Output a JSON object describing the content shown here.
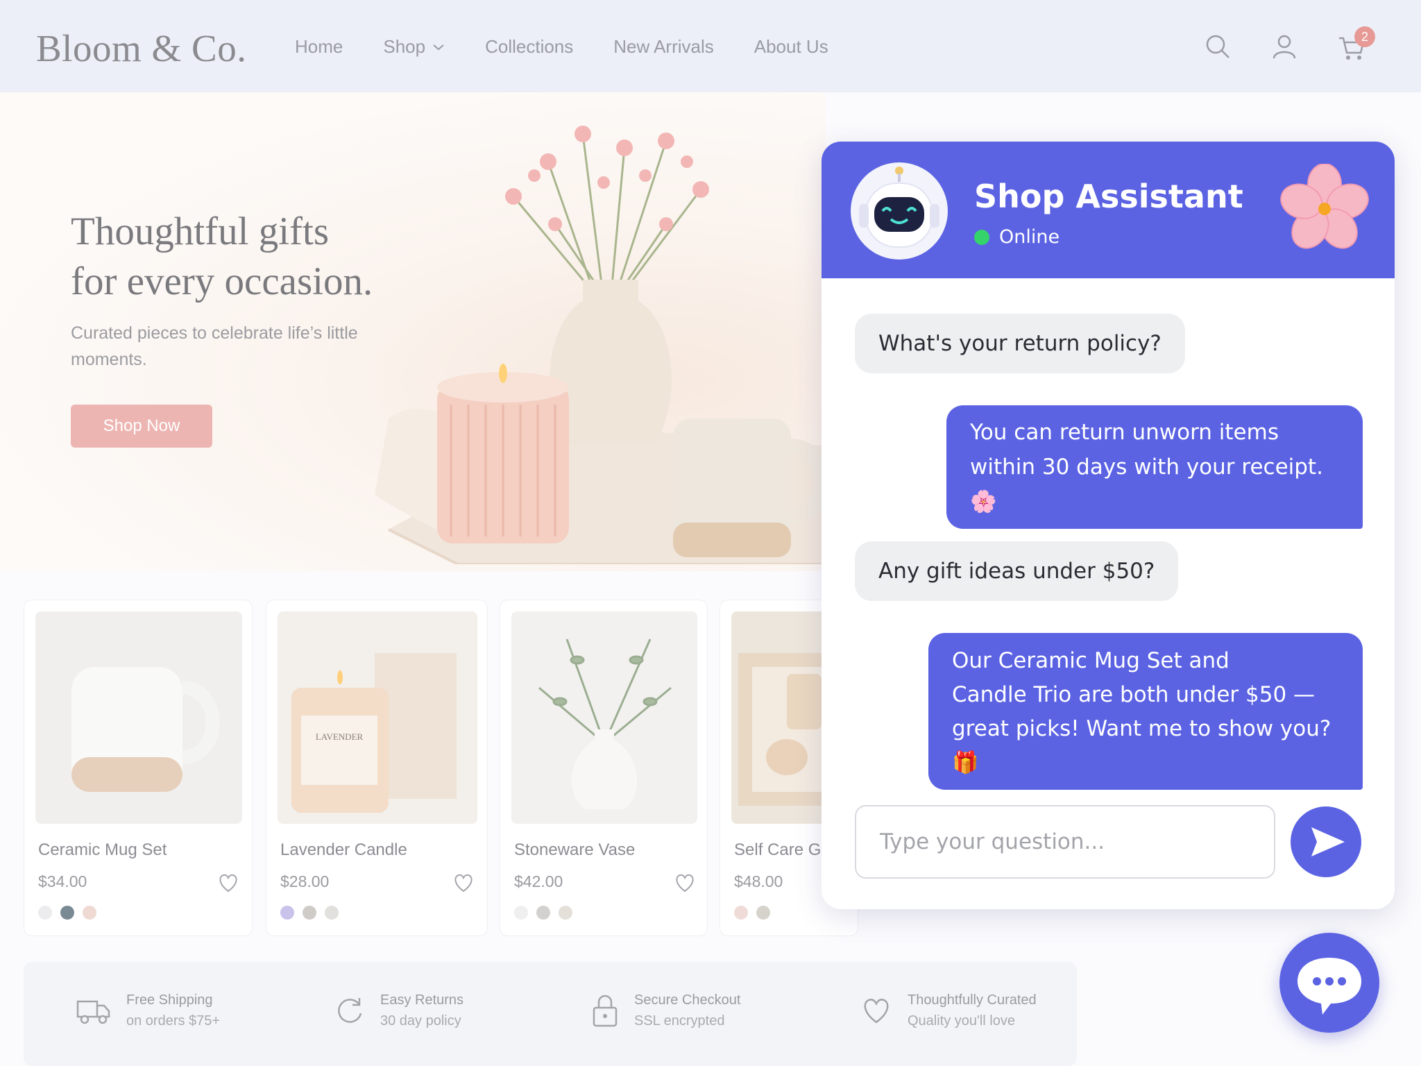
{
  "header": {
    "logo": "Bloom & Co.",
    "nav": [
      {
        "label": "Home"
      },
      {
        "label": "Shop"
      },
      {
        "label": "Collections"
      },
      {
        "label": "New Arrivals"
      },
      {
        "label": "About Us"
      }
    ],
    "cart_count": "2",
    "icons": [
      "search-icon",
      "user-icon",
      "cart-icon"
    ]
  },
  "hero": {
    "title_line1": "Thoughtful gifts",
    "title_line2": "for every occasion.",
    "subtitle": "Curated pieces to celebrate life’s little moments.",
    "cta": "Shop Now"
  },
  "products": [
    {
      "name": "Ceramic Mug Set",
      "price": "$34.00",
      "swatches": [
        "#ececee",
        "#7a8a94",
        "#efd9d3"
      ]
    },
    {
      "name": "Lavender Candle",
      "price": "$28.00",
      "swatches": [
        "#c9c2ea",
        "#cfccc8",
        "#e2e0dc"
      ]
    },
    {
      "name": "Stoneware Vase",
      "price": "$42.00",
      "swatches": [
        "#efefef",
        "#d3d1cf",
        "#e4e0d9"
      ]
    },
    {
      "name": "Self Care Gi",
      "price": "$48.00",
      "swatches": [
        "#efdcd8",
        "#d6d2cc"
      ]
    }
  ],
  "features": [
    {
      "title": "Free Shipping",
      "sub": "on orders $75+",
      "icon": "truck-icon"
    },
    {
      "title": "Easy Returns",
      "sub": "30 day policy",
      "icon": "refresh-icon"
    },
    {
      "title": "Secure Checkout",
      "sub": "SSL encrypted",
      "icon": "lock-icon"
    },
    {
      "title": "Thoughtfully Curated",
      "sub": "Quality you'll love",
      "icon": "heart-icon"
    }
  ],
  "chat": {
    "title": "Shop Assistant",
    "status": "Online",
    "messages": [
      {
        "from": "user",
        "text": "What's your return policy?"
      },
      {
        "from": "bot",
        "line1": "You can return unworn items",
        "line2": "within 30 days with your receipt. 🌸"
      },
      {
        "from": "user",
        "text": "Any gift ideas under $50?"
      },
      {
        "from": "bot",
        "line1": "Our Ceramic Mug Set and",
        "line2": "Candle Trio are both under $50 —",
        "line3": "great picks! Want me to show you? 🎁"
      }
    ],
    "input_placeholder": "Type your question...",
    "accent": "#5b63e3",
    "online_color": "#34d46a"
  },
  "colors": {
    "header_bg": "#eceff7",
    "cta_bg": "#edb5b2",
    "badge": "#e79a95"
  }
}
